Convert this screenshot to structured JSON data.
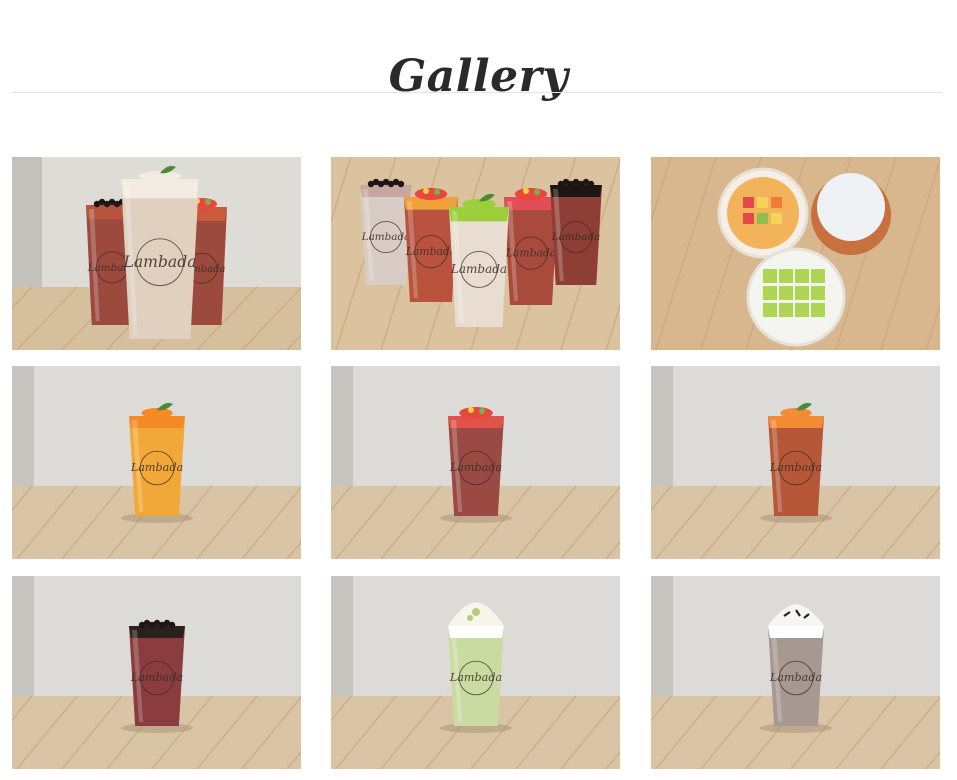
{
  "gallery": {
    "title": "Gallery",
    "brand_label": "Lambada",
    "photos": [
      {
        "name": "photo-three-drinks",
        "scene": "group3"
      },
      {
        "name": "photo-five-drinks",
        "scene": "group5"
      },
      {
        "name": "photo-toppings-cups",
        "scene": "topview"
      },
      {
        "name": "photo-mango-drink",
        "scene": "single",
        "liquid": "#f2a838",
        "top": "#f48a24",
        "garnish": "leaf"
      },
      {
        "name": "photo-strawberry-tea",
        "scene": "single",
        "liquid": "#9a4a42",
        "top": "#e0524a",
        "garnish": "fruit"
      },
      {
        "name": "photo-peach-tea",
        "scene": "single",
        "liquid": "#b65838",
        "top": "#f38a34",
        "garnish": "leaf"
      },
      {
        "name": "photo-boba-tea",
        "scene": "single",
        "liquid": "#8a3c3e",
        "top": "#2a201c",
        "garnish": "pearls"
      },
      {
        "name": "photo-matcha-frappe",
        "scene": "single",
        "liquid": "#c9dba0",
        "top": "#ffffff",
        "garnish": "cream-matcha"
      },
      {
        "name": "photo-cookie-frappe",
        "scene": "single",
        "liquid": "#a89892",
        "top": "#ffffff",
        "garnish": "cream-choc"
      }
    ]
  }
}
